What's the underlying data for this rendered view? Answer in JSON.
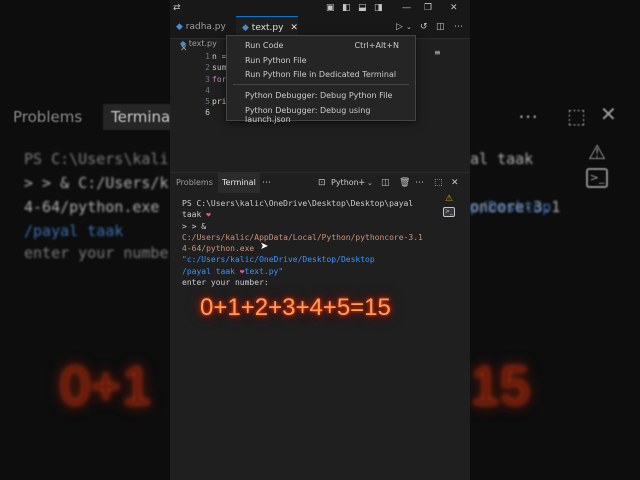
{
  "background": {
    "left_tab": "Problems",
    "left_tab_active": "Terminal",
    "left_line1": "PS C:\\Users\\kali",
    "left_line2": "> > & C:/Users/k",
    "left_line3": "4-64/python.exe",
    "left_line4": "/payal taak",
    "left_line5": "enter your numbe",
    "right_line1": "al taak",
    "right_line2": "oncore-3.1",
    "right_line3": "p/Desktop",
    "left_big": "0+1",
    "right_big": "15"
  },
  "editor": {
    "tabs": [
      {
        "label": "radha.py"
      },
      {
        "label": "text.py"
      }
    ],
    "breadcrumb": "text.py",
    "line_numbers": [
      "1",
      "2",
      "3",
      "4",
      "5",
      "6"
    ],
    "code_lines": [
      "n =",
      "sum",
      "for",
      "",
      "pri",
      ""
    ]
  },
  "run_menu": {
    "items": [
      {
        "label": "Run Code",
        "shortcut": "Ctrl+Alt+N"
      },
      {
        "label": "Run Python File",
        "shortcut": ""
      },
      {
        "label": "Run Python File in Dedicated Terminal",
        "shortcut": ""
      },
      {
        "label": "Python Debugger: Debug Python File",
        "shortcut": ""
      },
      {
        "label": "Python Debugger: Debug using launch.json",
        "shortcut": ""
      }
    ]
  },
  "panel": {
    "tab_problems": "Problems",
    "tab_terminal": "Terminal",
    "shell_label": "Python"
  },
  "terminal": {
    "line1_prefix": "PS C:\\Users\\kalic\\OneDrive\\Desktop\\Desktop\\payal taak",
    "line2_prefix": "> > & ",
    "line2_path": "C:/Users/kalic/AppData/Local/Python/pythoncore-3.1",
    "line3_path": "4-64/python.exe",
    "line3_str": "\"c:/Users/kalic/OneDrive/Desktop/Desktop",
    "line4_str_a": "/payal taak ",
    "line4_str_b": "text.py\"",
    "line5": "enter your number:"
  },
  "overlay_text": "0+1+2+3+4+5=15",
  "colors": {
    "accent": "#0078d4",
    "overlay": "#ff9e5a",
    "heart": "#e2558a"
  }
}
